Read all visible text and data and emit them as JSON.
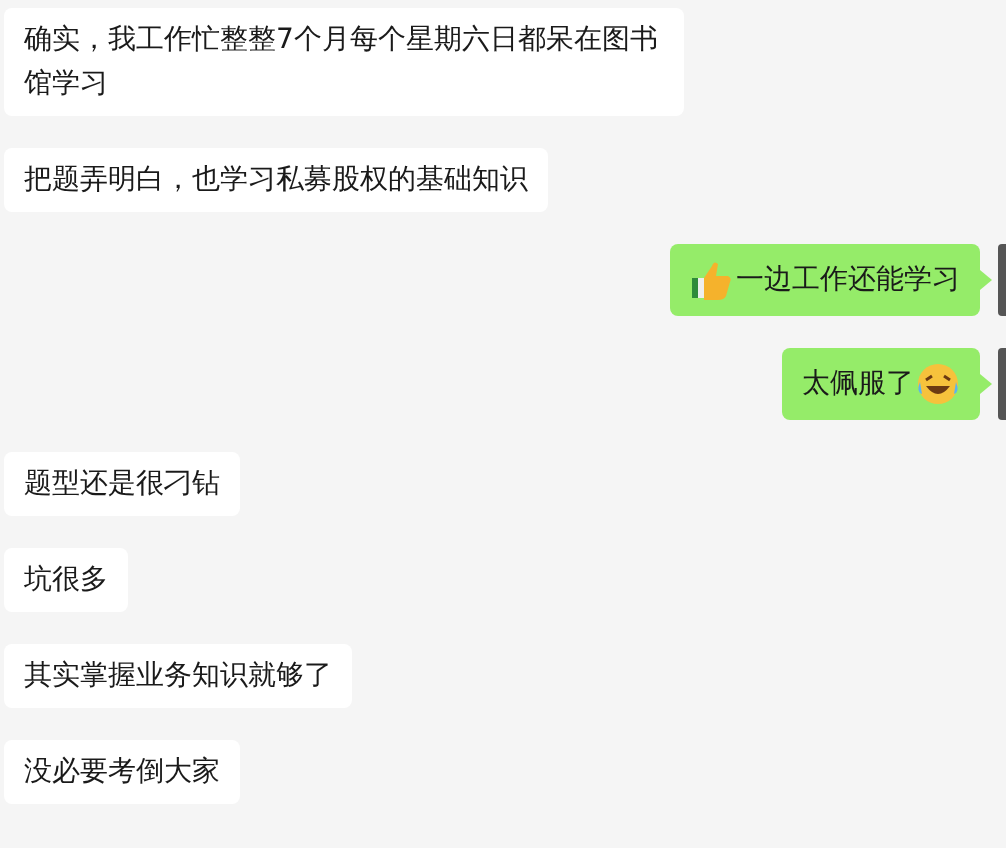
{
  "messages": [
    {
      "kind": "received",
      "text": "确实，我工作忙整整7个月每个星期六日都呆在图书馆学习"
    },
    {
      "kind": "received",
      "text": "把题弄明白，也学习私募股权的基础知识"
    },
    {
      "kind": "sent-thumbsup",
      "text": "一边工作还能学习"
    },
    {
      "kind": "sent-laughing",
      "text": "太佩服了"
    },
    {
      "kind": "received",
      "text": "题型还是很刁钻"
    },
    {
      "kind": "received",
      "text": "坑很多"
    },
    {
      "kind": "received",
      "text": "其实掌握业务知识就够了"
    },
    {
      "kind": "received",
      "text": "没必要考倒大家"
    }
  ]
}
